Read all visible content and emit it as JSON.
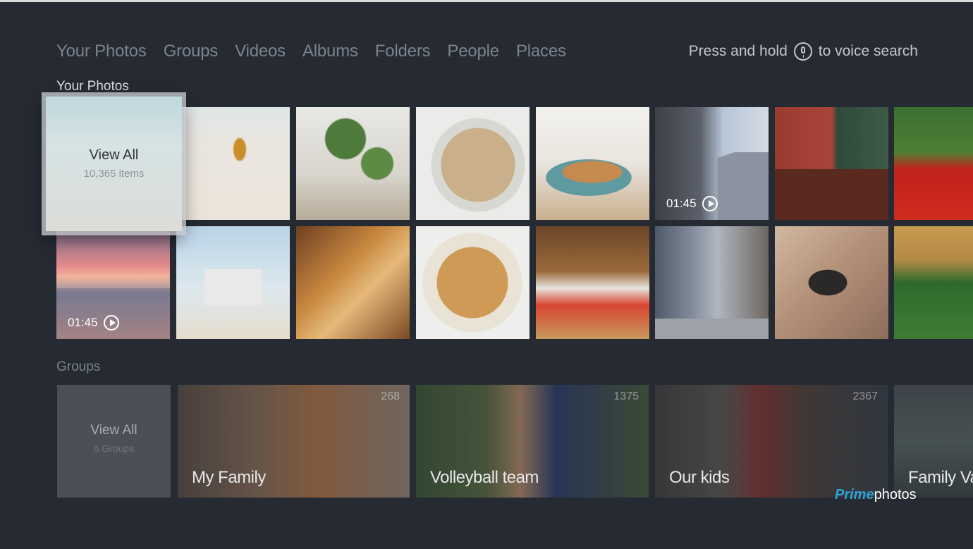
{
  "nav": {
    "items": [
      "Your Photos",
      "Groups",
      "Videos",
      "Albums",
      "Folders",
      "People",
      "Places"
    ]
  },
  "voice": {
    "before": "Press and hold",
    "icon": "microphone-icon",
    "after": "to voice search"
  },
  "photos": {
    "title": "Your Photos",
    "view_all": {
      "label": "View All",
      "count": "10,365 items"
    },
    "video_durations": [
      "01:45",
      "01:45"
    ]
  },
  "groups": {
    "title": "Groups",
    "view_all": {
      "label": "View All",
      "count": "6 Groups"
    },
    "items": [
      {
        "name": "My Family",
        "count": "268"
      },
      {
        "name": "Volleyball team",
        "count": "1375"
      },
      {
        "name": "Our kids",
        "count": "2367"
      },
      {
        "name": "Family Va",
        "count": ""
      }
    ]
  },
  "brand": {
    "prime": "Prime",
    "photos": "photos"
  },
  "colors": {
    "background": "#252a33",
    "accent": "#2ea2d8"
  }
}
